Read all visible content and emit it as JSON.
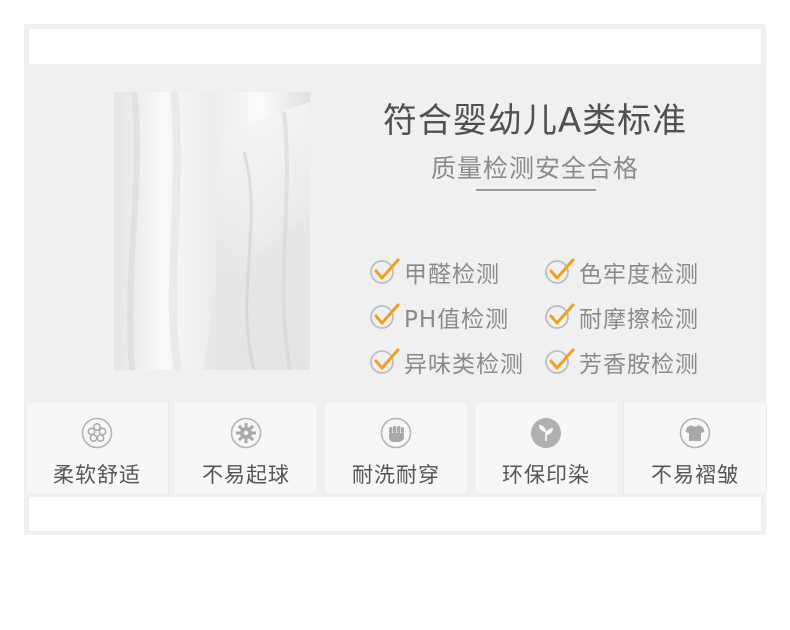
{
  "title": "符合婴幼儿A类标准",
  "subtitle": "质量检测安全合格",
  "tests": [
    {
      "label": "甲醛检测",
      "icon": "check-icon"
    },
    {
      "label": "色牢度检测",
      "icon": "check-icon"
    },
    {
      "label": "PH值检测",
      "icon": "check-icon"
    },
    {
      "label": "耐摩擦检测",
      "icon": "check-icon"
    },
    {
      "label": "异味类检测",
      "icon": "check-icon"
    },
    {
      "label": "芳香胺检测",
      "icon": "check-icon"
    }
  ],
  "features": [
    {
      "label": "柔软舒适",
      "icon": "cotton-flower-icon"
    },
    {
      "label": "不易起球",
      "icon": "gear-icon"
    },
    {
      "label": "耐洗耐穿",
      "icon": "fist-icon"
    },
    {
      "label": "环保印染",
      "icon": "leaf-icon"
    },
    {
      "label": "不易褶皱",
      "icon": "tshirt-icon"
    }
  ],
  "colors": {
    "accent_check": "#f0a020",
    "text_dark": "#505050",
    "text_light": "#8a8a8a",
    "panel_bg": "#f0f0f0"
  }
}
